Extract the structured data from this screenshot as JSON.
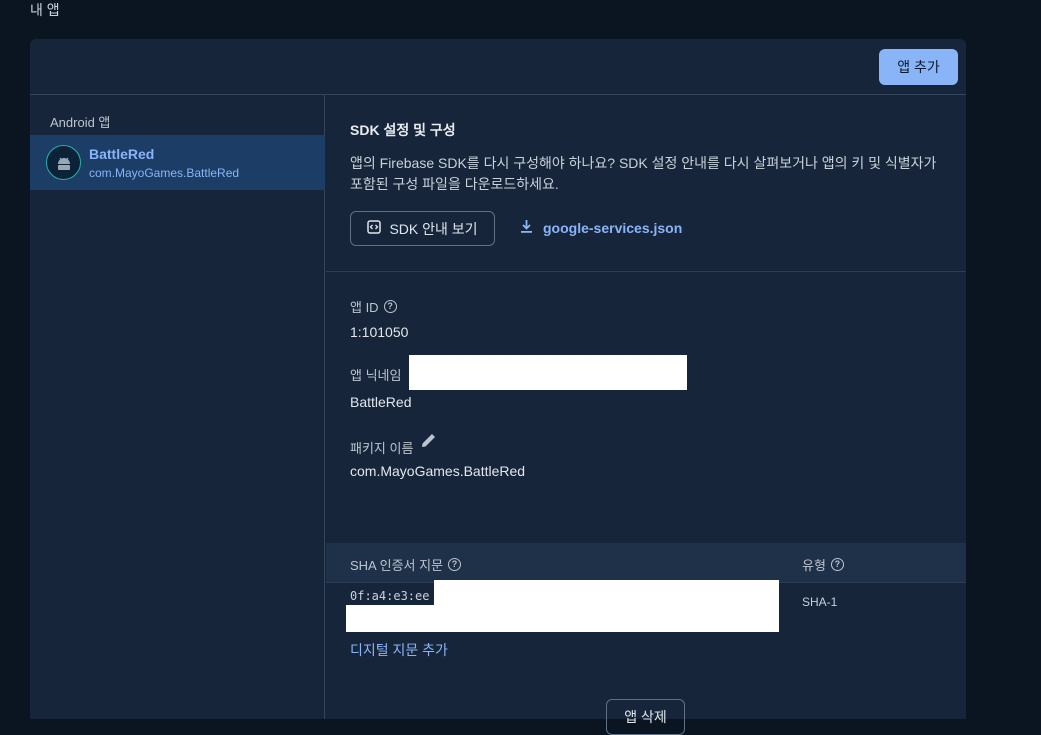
{
  "page": {
    "section_title": "내 앱"
  },
  "header": {
    "add_app_label": "앱 추가"
  },
  "sidebar": {
    "heading": "Android 앱",
    "apps": [
      {
        "name": "BattleRed",
        "package": "com.MayoGames.BattleRed",
        "icon": "android-icon"
      }
    ]
  },
  "sdk": {
    "title": "SDK 설정 및 구성",
    "description": "앱의 Firebase SDK를 다시 구성해야 하나요? SDK 설정 안내를 다시 살펴보거나 앱의 키 및 식별자가 포함된 구성 파일을 다운로드하세요.",
    "guide_button": "SDK 안내 보기",
    "download_link": "google-services.json"
  },
  "fields": {
    "app_id_label": "앱 ID",
    "app_id_value": "1:101050",
    "nickname_label": "앱 닉네임",
    "nickname_value": "BattleRed",
    "package_label": "패키지 이름",
    "package_value": "com.MayoGames.BattleRed"
  },
  "sha_table": {
    "col_fingerprint": "SHA 인증서 지문",
    "col_type": "유형",
    "rows": [
      {
        "fingerprint": "0f:a4:e3:ee",
        "type": "SHA-1"
      }
    ],
    "add_fingerprint": "디지털 지문 추가"
  },
  "footer": {
    "delete_app_label": "앱 삭제"
  },
  "colors": {
    "accent": "#8ab4f8",
    "card_bg": "#16253a",
    "page_bg": "#0b1522",
    "selected_bg": "#1b3d66"
  }
}
